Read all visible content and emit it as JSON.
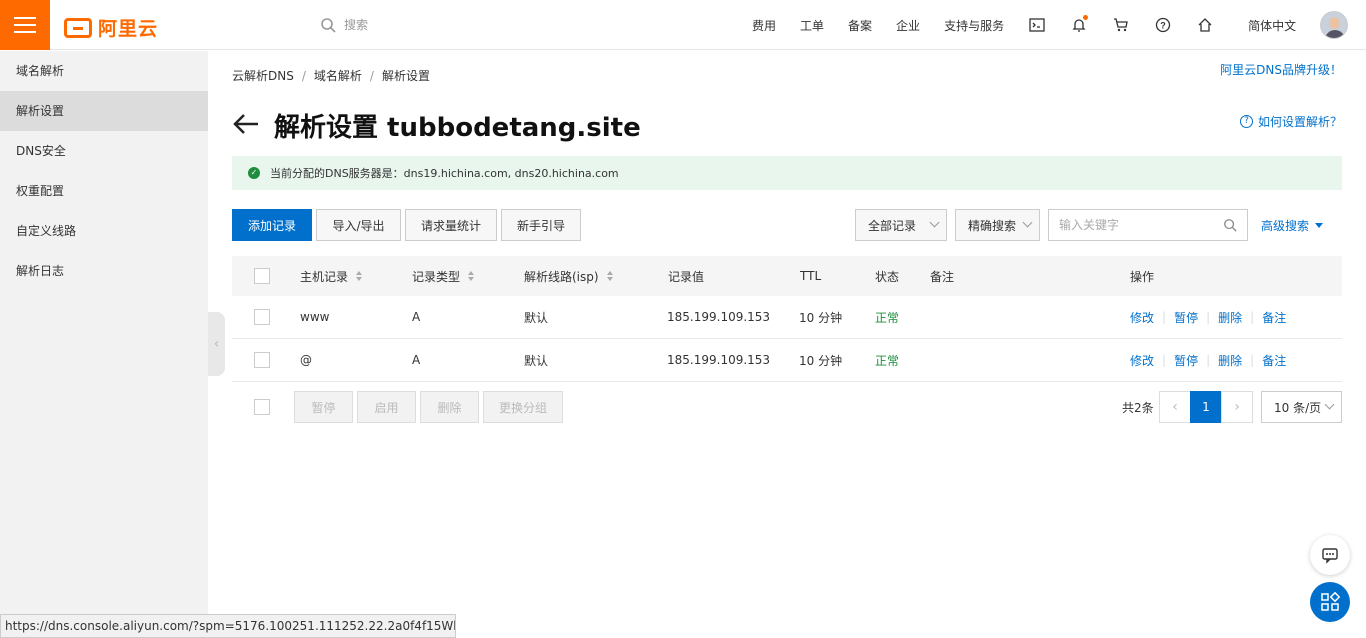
{
  "header": {
    "logo_text": "阿里云",
    "search_placeholder": "搜索",
    "nav": [
      "费用",
      "工单",
      "备案",
      "企业",
      "支持与服务"
    ],
    "language": "简体中文",
    "accent_color": "#ff6a00"
  },
  "sidebar": {
    "items": [
      {
        "label": "域名解析"
      },
      {
        "label": "解析设置"
      },
      {
        "label": "DNS安全"
      },
      {
        "label": "权重配置"
      },
      {
        "label": "自定义线路"
      },
      {
        "label": "解析日志"
      }
    ],
    "active_index": 1
  },
  "breadcrumb": [
    "云解析DNS",
    "域名解析",
    "解析设置"
  ],
  "promo_link": "阿里云DNS品牌升级！",
  "page_title": "解析设置 tubbodetang.site",
  "help_link": "如何设置解析？",
  "alert": {
    "text": "当前分配的DNS服务器是：dns19.hichina.com, dns20.hichina.com"
  },
  "toolbar": {
    "add_record": "添加记录",
    "import_export": "导入/导出",
    "request_stats": "请求量统计",
    "guide": "新手引导",
    "record_filter": "全部记录",
    "search_mode": "精确搜索",
    "keyword_placeholder": "输入关键字",
    "advanced_search": "高级搜索"
  },
  "table": {
    "columns": [
      "主机记录",
      "记录类型",
      "解析线路(isp)",
      "记录值",
      "TTL",
      "状态",
      "备注",
      "操作"
    ],
    "rows": [
      {
        "host": "www",
        "type": "A",
        "line": "默认",
        "value": "185.199.109.153",
        "ttl": "10 分钟",
        "status": "正常",
        "note": ""
      },
      {
        "host": "@",
        "type": "A",
        "line": "默认",
        "value": "185.199.109.153",
        "ttl": "10 分钟",
        "status": "正常",
        "note": ""
      }
    ],
    "actions": [
      "修改",
      "暂停",
      "删除",
      "备注"
    ]
  },
  "footer": {
    "bulk_pause": "暂停",
    "bulk_enable": "启用",
    "bulk_delete": "删除",
    "bulk_group": "更换分组",
    "total": "共2条",
    "current_page": "1",
    "page_size": "10 条/页"
  },
  "status_url": "https://dns.console.aliyun.com/?spm=5176.100251.111252.22.2a0f4f15WhJG..."
}
